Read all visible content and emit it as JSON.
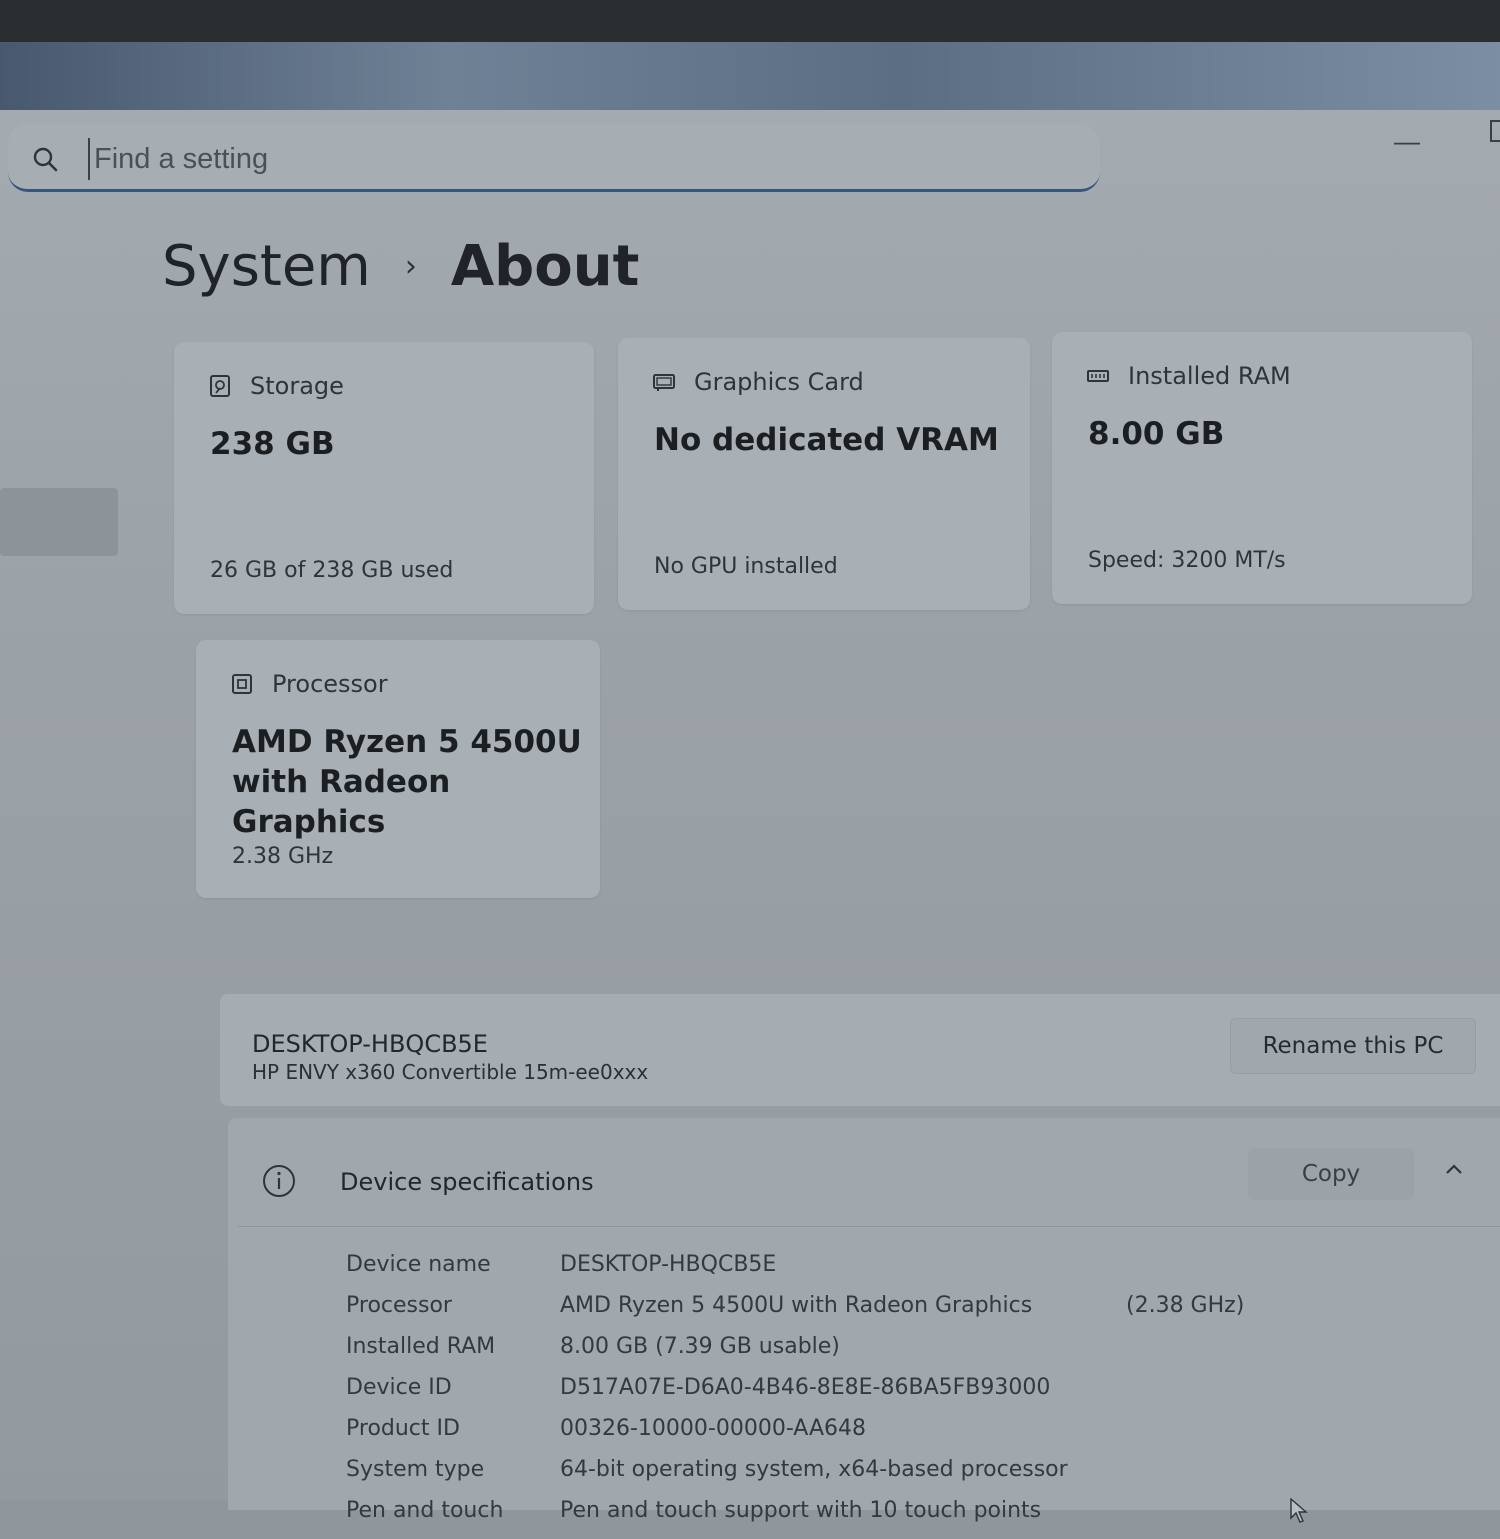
{
  "search": {
    "placeholder": "Find a setting"
  },
  "window": {
    "minimize_label": "—"
  },
  "breadcrumb": {
    "root": "System",
    "separator": "›",
    "current": "About"
  },
  "cards": {
    "storage": {
      "label": "Storage",
      "value": "238 GB",
      "detail": "26 GB of 238 GB used",
      "icon": "storage-icon"
    },
    "graphics": {
      "label": "Graphics Card",
      "value": "No dedicated VRAM",
      "detail": "No GPU installed",
      "icon": "graphics-card-icon"
    },
    "ram": {
      "label": "Installed RAM",
      "value": "8.00 GB",
      "detail": "Speed: 3200 MT/s",
      "icon": "ram-icon"
    },
    "processor": {
      "label": "Processor",
      "value_line1": "AMD Ryzen 5 4500U",
      "value_line2": "with Radeon Graphics",
      "detail": "2.38 GHz",
      "icon": "processor-icon"
    }
  },
  "pc": {
    "name": "DESKTOP-HBQCB5E",
    "model": "HP ENVY x360 Convertible 15m-ee0xxx",
    "rename_label": "Rename this PC"
  },
  "device_specifications": {
    "title": "Device specifications",
    "copy_label": "Copy",
    "rows": [
      {
        "label": "Device name",
        "value": "DESKTOP-HBQCB5E",
        "extra": ""
      },
      {
        "label": "Processor",
        "value": "AMD Ryzen 5 4500U with Radeon Graphics",
        "extra": "(2.38 GHz)"
      },
      {
        "label": "Installed RAM",
        "value": "8.00 GB (7.39 GB usable)",
        "extra": ""
      },
      {
        "label": "Device ID",
        "value": "D517A07E-D6A0-4B46-8E8E-86BA5FB93000",
        "extra": ""
      },
      {
        "label": "Product ID",
        "value": "00326-10000-00000-AA648",
        "extra": ""
      },
      {
        "label": "System type",
        "value": "64-bit operating system, x64-based processor",
        "extra": ""
      },
      {
        "label": "Pen and touch",
        "value": "Pen and touch support with 10 touch points",
        "extra": ""
      }
    ]
  },
  "colors": {
    "accent": "#38557e",
    "window_background": "#9aa1a7",
    "card_background": "#a9b0b5"
  }
}
